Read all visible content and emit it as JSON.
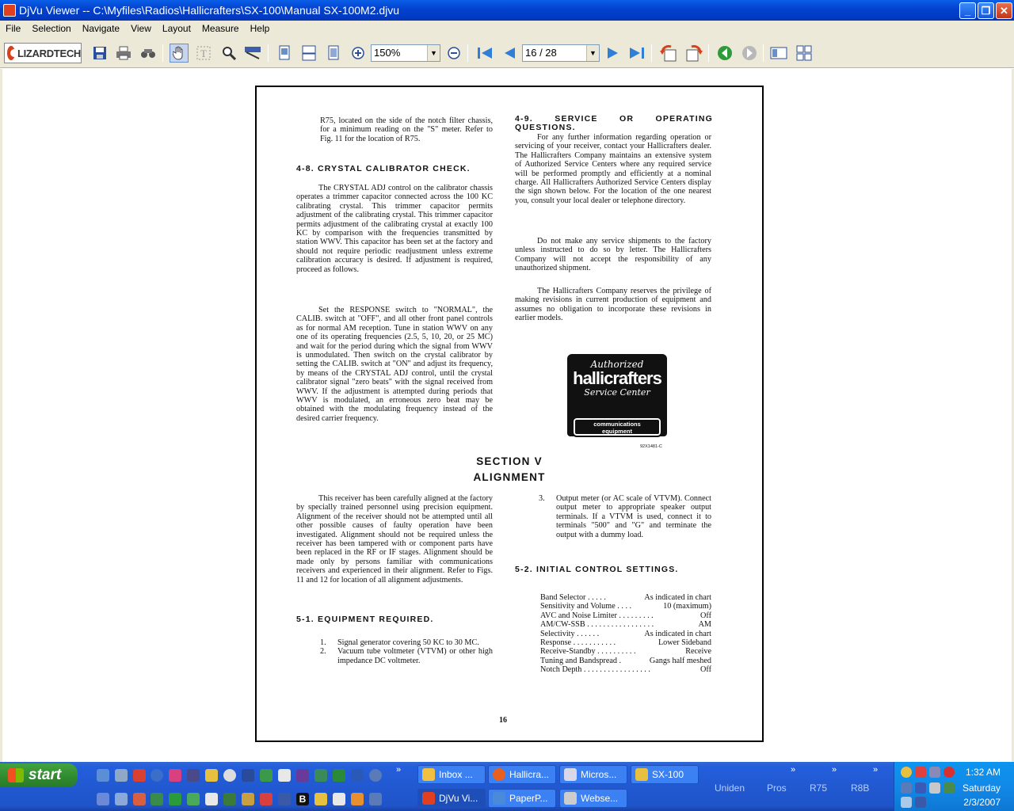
{
  "window": {
    "title": "DjVu Viewer -- C:\\Myfiles\\Radios\\Hallicrafters\\SX-100\\Manual SX-100M2.djvu",
    "controls": {
      "minimize": "_",
      "maximize": "❐",
      "close": "✕"
    }
  },
  "menu": [
    "File",
    "Selection",
    "Navigate",
    "View",
    "Layout",
    "Measure",
    "Help"
  ],
  "toolbar": {
    "logo": "LIZARDTECH",
    "zoom_value": "150%",
    "page_value": "16 / 28",
    "icons": [
      "save-icon",
      "print-icon",
      "find-icon",
      "hand-icon",
      "text-select-icon",
      "zoom-select-icon",
      "ruler-icon",
      "single-page-icon",
      "continuous-icon",
      "facing-icon",
      "zoom-in-icon",
      "zoom-out-icon",
      "first-page-icon",
      "prev-page-icon",
      "next-page-icon",
      "last-page-icon",
      "rotate-left-icon",
      "rotate-right-icon",
      "back-icon",
      "forward-icon",
      "thumbnails-icon",
      "grid-icon"
    ]
  },
  "document": {
    "left": {
      "intro": "R75, located on the side of the notch filter chassis, for a minimum reading on the \"S\" meter. Refer to Fig. 11 for the location of R75.",
      "h48": "4-8.  CRYSTAL CALIBRATOR CHECK.",
      "p1": "The CRYSTAL ADJ control on the calibrator chassis operates a trimmer capacitor connected across the 100 KC calibrating crystal. This trimmer capacitor permits adjustment of the calibrating crystal. This trimmer capacitor permits adjustment of the calibrating crystal at exactly 100 KC by comparison with the frequencies transmitted by station WWV. This capacitor has been set at the factory and should not require periodic readjustment unless extreme calibration accuracy is desired. If adjustment is required, proceed as follows.",
      "p2": "Set the RESPONSE switch to \"NORMAL\", the CALIB. switch at \"OFF\", and all other front panel controls as for normal AM reception. Tune in station WWV on any one of its operating frequencies (2.5, 5, 10, 20, or 25 MC) and wait for the period during which the signal from WWV is unmodulated. Then switch on the crystal calibrator by setting the CALIB. switch at \"ON\" and adjust its frequency, by means of the CRYSTAL ADJ control, until the crystal calibrator signal \"zero beats\" with the signal received from WWV. If the adjustment is attempted during periods that WWV is modulated, an erroneous zero beat may be obtained with the modulating frequency instead of the desired carrier frequency."
    },
    "right": {
      "h49": "4-9.  SERVICE OR OPERATING QUESTIONS.",
      "p1": "For any further information regarding operation or servicing of your receiver, contact your Hallicrafters dealer. The Hallicrafters Company maintains an extensive system of Authorized Service Centers where any required service will be performed promptly and efficiently at a nominal charge. All Hallicrafters Authorized Service Centers display the sign shown below. For the location of the one nearest you, consult your local dealer or telephone directory.",
      "p2": "Do not make any service shipments to the factory unless instructed to do so by letter. The Hallicrafters Company will not accept the responsibility of any unauthorized shipment.",
      "p3": "The Hallicrafters Company reserves the privilege of making revisions in current production of equipment and assumes no obligation to incorporate these revisions in earlier models."
    },
    "logo": {
      "authorized": "Authorized",
      "brand": "hallicrafters",
      "service": "Service Center",
      "sub1": "communications",
      "sub2": "equipment",
      "code": "92X1481-C"
    },
    "section": {
      "line1": "SECTION V",
      "line2": "ALIGNMENT"
    },
    "lower_left": {
      "p1": "This receiver has been carefully aligned at the factory by specially trained personnel using precision equipment. Alignment of the receiver should not be attempted until all other possible causes of faulty operation have been investigated. Alignment should not be required unless the receiver has been tampered with or component parts have been replaced in the RF or IF stages. Alignment should be made only by persons familiar with communications receivers and experienced in their alignment. Refer to Figs. 11 and 12 for location of all alignment adjustments.",
      "h51": "5-1.  EQUIPMENT REQUIRED.",
      "items": [
        {
          "num": "1.",
          "text": "Signal generator covering 50 KC to 30 MC."
        },
        {
          "num": "2.",
          "text": "Vacuum tube voltmeter (VTVM) or other high impedance DC voltmeter."
        }
      ]
    },
    "lower_right": {
      "item3_num": "3.",
      "item3": "Output meter (or AC scale of VTVM). Connect output meter to appropriate speaker output terminals. If a VTVM is used, connect it to terminals \"500\" and \"G\" and terminate the output with a dummy load.",
      "h52": "5-2.  INITIAL CONTROL SETTINGS.",
      "settings": [
        {
          "label": "Band Selector . . . . .",
          "value": "As indicated in chart"
        },
        {
          "label": "Sensitivity and Volume . . . .",
          "value": "10 (maximum)"
        },
        {
          "label": "AVC and Noise Limiter . . . . . . . . .",
          "value": "Off"
        },
        {
          "label": "AM/CW-SSB . . . . . . . . . . . . . . . . .",
          "value": "AM"
        },
        {
          "label": "Selectivity . . . . . .",
          "value": "As indicated in chart"
        },
        {
          "label": "Response . . . . . . . . . . .",
          "value": "Lower Sideband"
        },
        {
          "label": "Receive-Standby . . . . . . . . . .",
          "value": "Receive"
        },
        {
          "label": "Tuning and Bandspread .",
          "value": "Gangs half meshed"
        },
        {
          "label": "Notch Depth . . . . . . . . . . . . . . . . .",
          "value": "Off"
        }
      ]
    },
    "page_number": "16"
  },
  "taskbar": {
    "start": "start",
    "tasks_row1": [
      "Inbox ...",
      "Hallicra...",
      "Micros...",
      "SX-100"
    ],
    "tasks_row2": [
      "DjVu Vi...",
      "PaperP...",
      "Webse..."
    ],
    "groups": [
      "Uniden",
      "Pros",
      "R75",
      "R8B"
    ],
    "time": "1:32 AM",
    "day": "Saturday",
    "date": "2/3/2007"
  }
}
